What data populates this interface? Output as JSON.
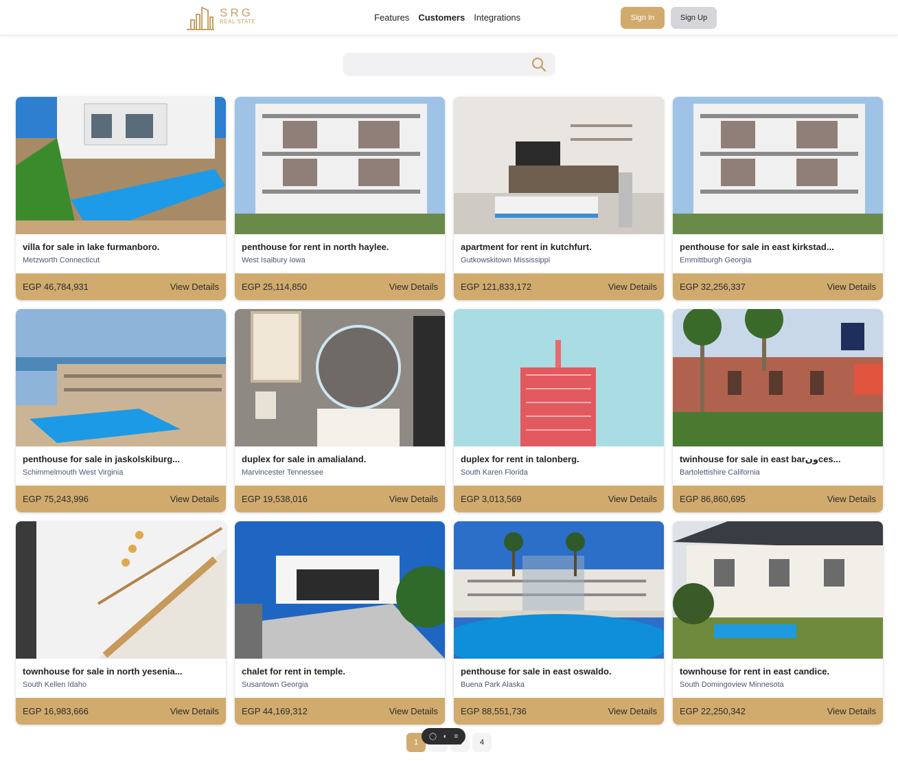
{
  "header": {
    "logo_brand": "SRG",
    "logo_sub": "REAL STATE",
    "nav": [
      {
        "label": "Features"
      },
      {
        "label": "Customers"
      },
      {
        "label": "Integrations"
      }
    ],
    "signin_label": "Sign In",
    "signup_label": "Sign Up"
  },
  "search": {
    "placeholder": "",
    "value": ""
  },
  "colors": {
    "accent": "#d1ab6e",
    "signup_bg": "#d6d6da"
  },
  "listings": [
    {
      "title": "villa for sale in lake furmanboro.",
      "location": "Metzworth Connecticut",
      "price": "EGP 46,784,931",
      "cta": "View Details",
      "image": "villa-pool"
    },
    {
      "title": "penthouse for rent in north haylee.",
      "location": "West Isaibury Iowa",
      "price": "EGP 25,114,850",
      "cta": "View Details",
      "image": "modern-building"
    },
    {
      "title": "apartment for rent in kutchfurt.",
      "location": "Gutkowskitown Mississippi",
      "price": "EGP 121,833,172",
      "cta": "View Details",
      "image": "living-room"
    },
    {
      "title": "penthouse for sale in east kirkstad...",
      "location": "Emmittburgh Georgia",
      "price": "EGP 32,256,337",
      "cta": "View Details",
      "image": "modern-building"
    },
    {
      "title": "penthouse for sale in jaskolskiburg...",
      "location": "Schimmelmouth West Virginia",
      "price": "EGP 75,243,996",
      "cta": "View Details",
      "image": "resort-pool"
    },
    {
      "title": "duplex for sale in amalialand.",
      "location": "Marvincester Tennessee",
      "price": "EGP 19,538,016",
      "cta": "View Details",
      "image": "bathroom-mirror"
    },
    {
      "title": "duplex for rent in talonberg.",
      "location": "South Karen Florida",
      "price": "EGP 3,013,569",
      "cta": "View Details",
      "image": "red-tower"
    },
    {
      "title": "twinhouse for sale in east barونces...",
      "location": "Bartolettishire California",
      "price": "EGP 86,860,695",
      "cta": "View Details",
      "image": "palm-villa"
    },
    {
      "title": "townhouse for sale in north yesenia...",
      "location": "South Kellen Idaho",
      "price": "EGP 16,983,666",
      "cta": "View Details",
      "image": "staircase"
    },
    {
      "title": "chalet for rent in temple.",
      "location": "Susantown Georgia",
      "price": "EGP 44,169,312",
      "cta": "View Details",
      "image": "white-chalet"
    },
    {
      "title": "penthouse for sale in east oswaldo.",
      "location": "Buena Park Alaska",
      "price": "EGP 88,551,736",
      "cta": "View Details",
      "image": "compound-pool"
    },
    {
      "title": "townhouse for rent in east candice.",
      "location": "South Domingoview Minnesota",
      "price": "EGP 22,250,342",
      "cta": "View Details",
      "image": "classic-villa"
    }
  ],
  "pagination": {
    "pages": [
      "1",
      "2",
      "3",
      "4"
    ],
    "current": "1"
  }
}
